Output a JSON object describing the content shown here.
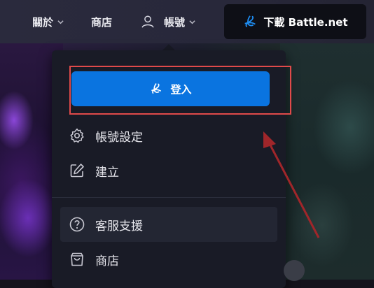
{
  "nav": {
    "about_label": "關於",
    "shop_label": "商店",
    "account_label": "帳號",
    "download_label": "下載 Battle.net"
  },
  "dropdown": {
    "login_label": "登入",
    "items": [
      {
        "label": "帳號設定",
        "icon": "gear-icon"
      },
      {
        "label": "建立",
        "icon": "edit-icon"
      },
      {
        "label": "客服支援",
        "icon": "help-icon"
      },
      {
        "label": "商店",
        "icon": "shopping-bag-icon"
      }
    ]
  },
  "colors": {
    "accent": "#0a74e0",
    "highlight_box": "#e04a4a",
    "annotation_arrow": "#a0262a"
  }
}
